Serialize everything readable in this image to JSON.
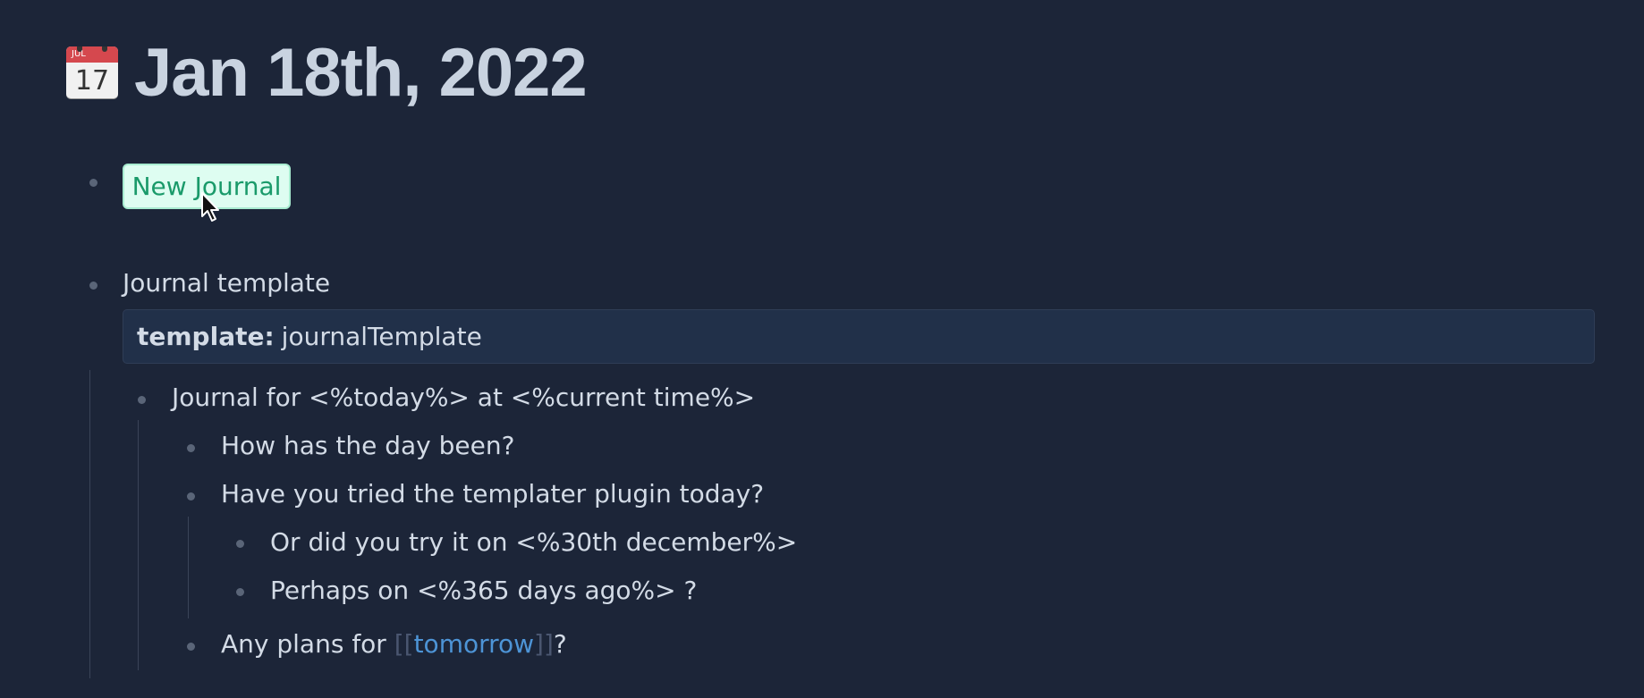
{
  "page": {
    "title": "Jan 18th, 2022",
    "calendar_icon": {
      "month": "JUL",
      "day": "17"
    }
  },
  "blocks": {
    "new_journal_button": "New Journal",
    "journal_template_label": "Journal template",
    "property": {
      "key": "template:",
      "value": "journalTemplate"
    },
    "items": [
      "Journal for <%today%> at <%current time%>",
      "How has the day been?",
      "Have you tried the templater plugin today?",
      "Or did you try it on <%30th december%>",
      "Perhaps on <%365 days ago%> ?"
    ],
    "plans": {
      "prefix": "Any plans for ",
      "open_bracket": "[[",
      "link": "tomorrow",
      "close_bracket": "]]",
      "suffix": "?"
    }
  },
  "colors": {
    "background": "#1c2538",
    "button_bg": "#defdf1",
    "button_text": "#1a9a6a",
    "link": "#4d94d6"
  }
}
